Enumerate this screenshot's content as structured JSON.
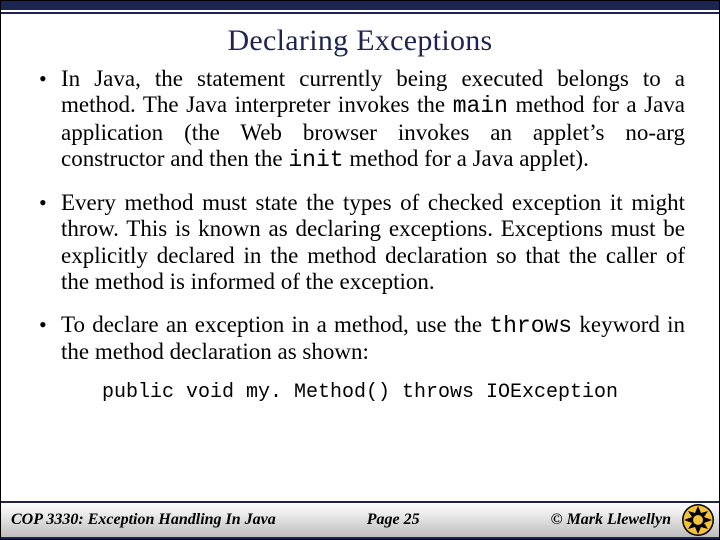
{
  "title": "Declaring Exceptions",
  "bullets": {
    "b1a": "In Java, the statement currently being executed belongs to a method. The Java interpreter invokes the ",
    "b1_code1": "main",
    "b1b": " method for a Java application (the Web browser invokes an applet’s no-arg constructor and then the ",
    "b1_code2": "init",
    "b1c": " method for a Java applet).",
    "b2": "Every method must state the types of checked exception it might throw.  This is known as declaring exceptions.  Exceptions must be explicitly declared in the method declaration so that the caller of the method is informed of the exception.",
    "b3a": "To declare an exception in a method, use the ",
    "b3_code": "throws",
    "b3b": " keyword in the method declaration as shown:"
  },
  "code_line": "public void my. Method() throws IOException",
  "footer": {
    "course": "COP 3330:  Exception Handling In Java",
    "page": "Page 25",
    "author": "© Mark Llewellyn"
  }
}
